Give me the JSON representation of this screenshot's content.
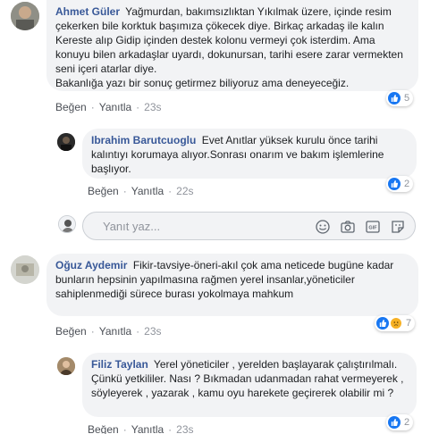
{
  "comments": [
    {
      "author": "Ahmet Güler",
      "text": "Yağmurdan, bakımsızlıktan Yıkılmak üzere, içinde resim çekerken bile korktuk başımıza çökecek diye. Birkaç arkadaş ile kalın Kereste alıp Gidip içinden destek kolonu vermeyi çok isterdim. Ama konuyu bilen arkadaşlar uyardı, dokunursan, tarihi esere zarar vermekten seni içeri atarlar diye.",
      "text2": "Bakanlığa yazı bir sonuç getirmez biliyoruz ama deneyeceğiz.",
      "reaction_count": "5",
      "like": "Beğen",
      "reply": "Yanıtla",
      "time": "23s"
    },
    {
      "author": "Ibrahim Barutcuoglu",
      "text": "Evet Anıtlar yüksek kurulu önce tarihi kalıntıyı korumaya alıyor.Sonrası onarım ve bakım işlemlerine başlıyor.",
      "reaction_count": "2",
      "like": "Beğen",
      "reply": "Yanıtla",
      "time": "22s"
    },
    {
      "author": "Oğuz Aydemir",
      "text": "Fikir-tavsiye-öneri-akıl çok ama neticede bugüne kadar bunların hepsinin yapılmasına rağmen yerel insanlar,yöneticiler sahiplenmediği sürece burası yokolmaya mahkum",
      "reaction_count": "7",
      "like": "Beğen",
      "reply": "Yanıtla",
      "time": "23s"
    },
    {
      "author": "Filiz Taylan",
      "text": "Yerel yöneticiler , yerelden başlayarak çalıştırılmalı. Çünkü yetkililer. Nası ? Bıkmadan udanmadan rahat vermeyerek , söyleyerek , yazarak , kamu oyu harekete geçirerek olabilir mi ?",
      "reaction_count": "2",
      "like": "Beğen",
      "reply": "Yanıtla",
      "time": "23s"
    }
  ],
  "reply_box": {
    "placeholder": "Yanıt yaz...",
    "icons": [
      "emoji-icon",
      "camera-icon",
      "gif-icon",
      "sticker-icon"
    ]
  },
  "colors": {
    "name": "#385898",
    "bubble": "#f2f3f5",
    "like": "#1877f2",
    "meta": "#90949c"
  }
}
